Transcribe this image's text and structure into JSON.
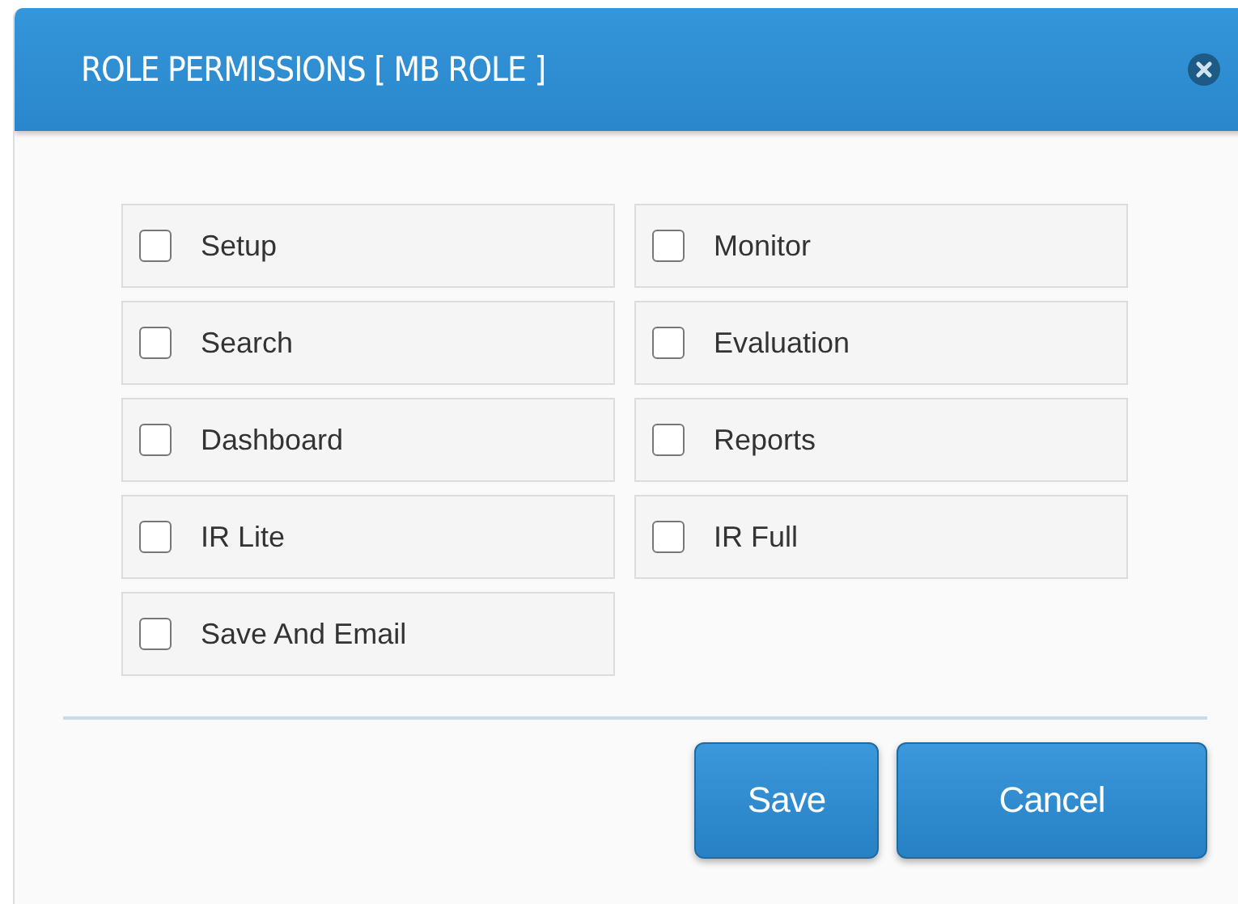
{
  "dialog": {
    "title": "ROLE PERMISSIONS [ MB ROLE ]"
  },
  "permissions": [
    {
      "label": "Setup",
      "checked": false
    },
    {
      "label": "Monitor",
      "checked": false
    },
    {
      "label": "Search",
      "checked": false
    },
    {
      "label": "Evaluation",
      "checked": false
    },
    {
      "label": "Dashboard",
      "checked": false
    },
    {
      "label": "Reports",
      "checked": false
    },
    {
      "label": "IR Lite",
      "checked": false
    },
    {
      "label": "IR Full",
      "checked": false
    },
    {
      "label": "Save And Email",
      "checked": false
    }
  ],
  "buttons": [
    {
      "label": "Save"
    },
    {
      "label": "Cancel"
    }
  ]
}
